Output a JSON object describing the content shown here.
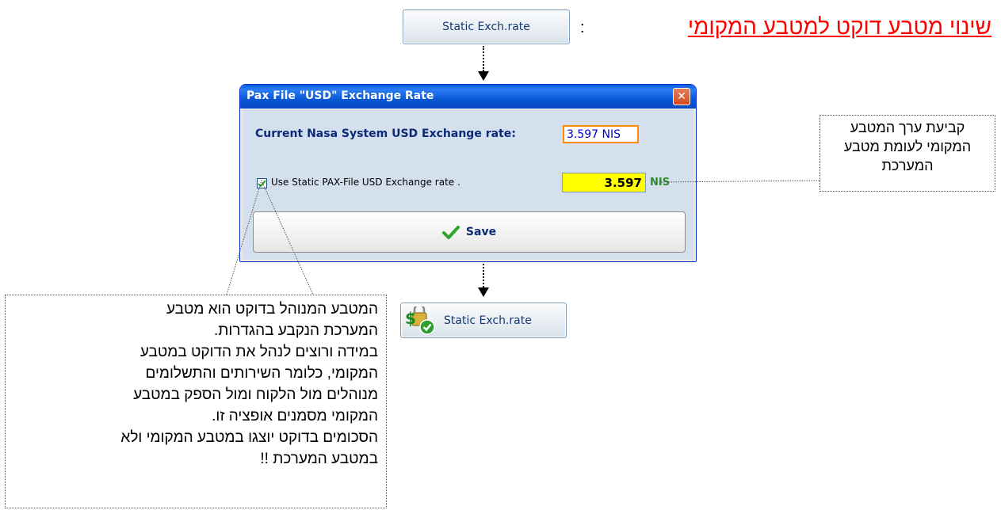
{
  "header": {
    "title": "שינוי מטבע דוקט למטבע המקומי",
    "colon": ":"
  },
  "top_button": {
    "label": "Static Exch.rate"
  },
  "dialog": {
    "title": "Pax File  \"USD\"  Exchange Rate",
    "close_icon": "close-icon",
    "current_rate_label": "Current Nasa System USD Exchange rate:",
    "current_rate_value": "3.597 NIS",
    "static_checkbox_checked": true,
    "static_label": "Use Static PAX-File USD Exchange rate .",
    "static_value": "3.597",
    "static_unit": "NIS",
    "save_label": "Save",
    "save_icon": "checkmark-icon"
  },
  "bottom_button": {
    "label": "Static Exch.rate",
    "icon": "dollar-lock-check-icon"
  },
  "callouts": {
    "right": [
      "קביעת ערך המטבע",
      "המקומי לעומת מטבע",
      "המערכת"
    ],
    "left": [
      "המטבע המנוהל בדוקט הוא מטבע",
      "המערכת הנקבע בהגדרות.",
      "במידה ורוצים לנהל את הדוקט במטבע",
      "המקומי, כלומר השירותים והתשלומים",
      "מנוהלים מול הלקוח ומול הספק במטבע",
      "המקומי מסמנים אופציה זו.",
      "הסכומים בדוקט יוצגו במטבע המקומי ולא",
      "במטבע המערכת !!"
    ]
  },
  "colors": {
    "title_red": "#ff0000",
    "dialog_title_blue": "#0a58d6",
    "accent_orange": "#ff8c00",
    "highlight_yellow": "#ffff00",
    "nis_green": "#2e8b2e"
  }
}
